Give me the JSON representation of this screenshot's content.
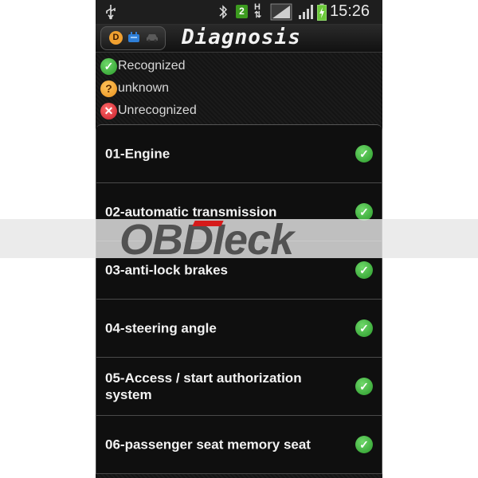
{
  "status_bar": {
    "icons": [
      "usb-icon",
      "bluetooth-icon",
      "sim-2-icon",
      "hspa-icon",
      "signal-icon",
      "signal-icon",
      "battery-charging-icon"
    ],
    "sim_label": "2",
    "network_label": "H",
    "time": "15:26"
  },
  "title_bar": {
    "title": "Diagnosis",
    "mode_icons": [
      "diagnosis-d-icon",
      "ecu-icon",
      "car-icon"
    ],
    "d_label": "D"
  },
  "legend": [
    {
      "label": "Recognized",
      "icon": "check-circle-icon",
      "color": "#2a9a2a"
    },
    {
      "label": "unknown",
      "icon": "question-circle-icon",
      "color": "#e8901e"
    },
    {
      "label": "Unrecognized",
      "icon": "x-circle-icon",
      "color": "#c81e2a"
    }
  ],
  "modules": [
    {
      "label": "01-Engine",
      "status": "Recognized"
    },
    {
      "label": "02-automatic transmission",
      "status": "Recognized"
    },
    {
      "label": "03-anti-lock brakes",
      "status": "Recognized"
    },
    {
      "label": "04-steering angle",
      "status": "Recognized"
    },
    {
      "label": "05-Access / start authorization system",
      "status": "Recognized"
    },
    {
      "label": "06-passenger seat memory seat",
      "status": "Recognized"
    }
  ],
  "watermark": {
    "text": "OBDIeck"
  },
  "colors": {
    "background": "#151515",
    "accent_green": "#2a9a2a",
    "accent_orange": "#e8901e",
    "accent_red": "#c81e2a",
    "watermark_red": "#d61a1a"
  }
}
